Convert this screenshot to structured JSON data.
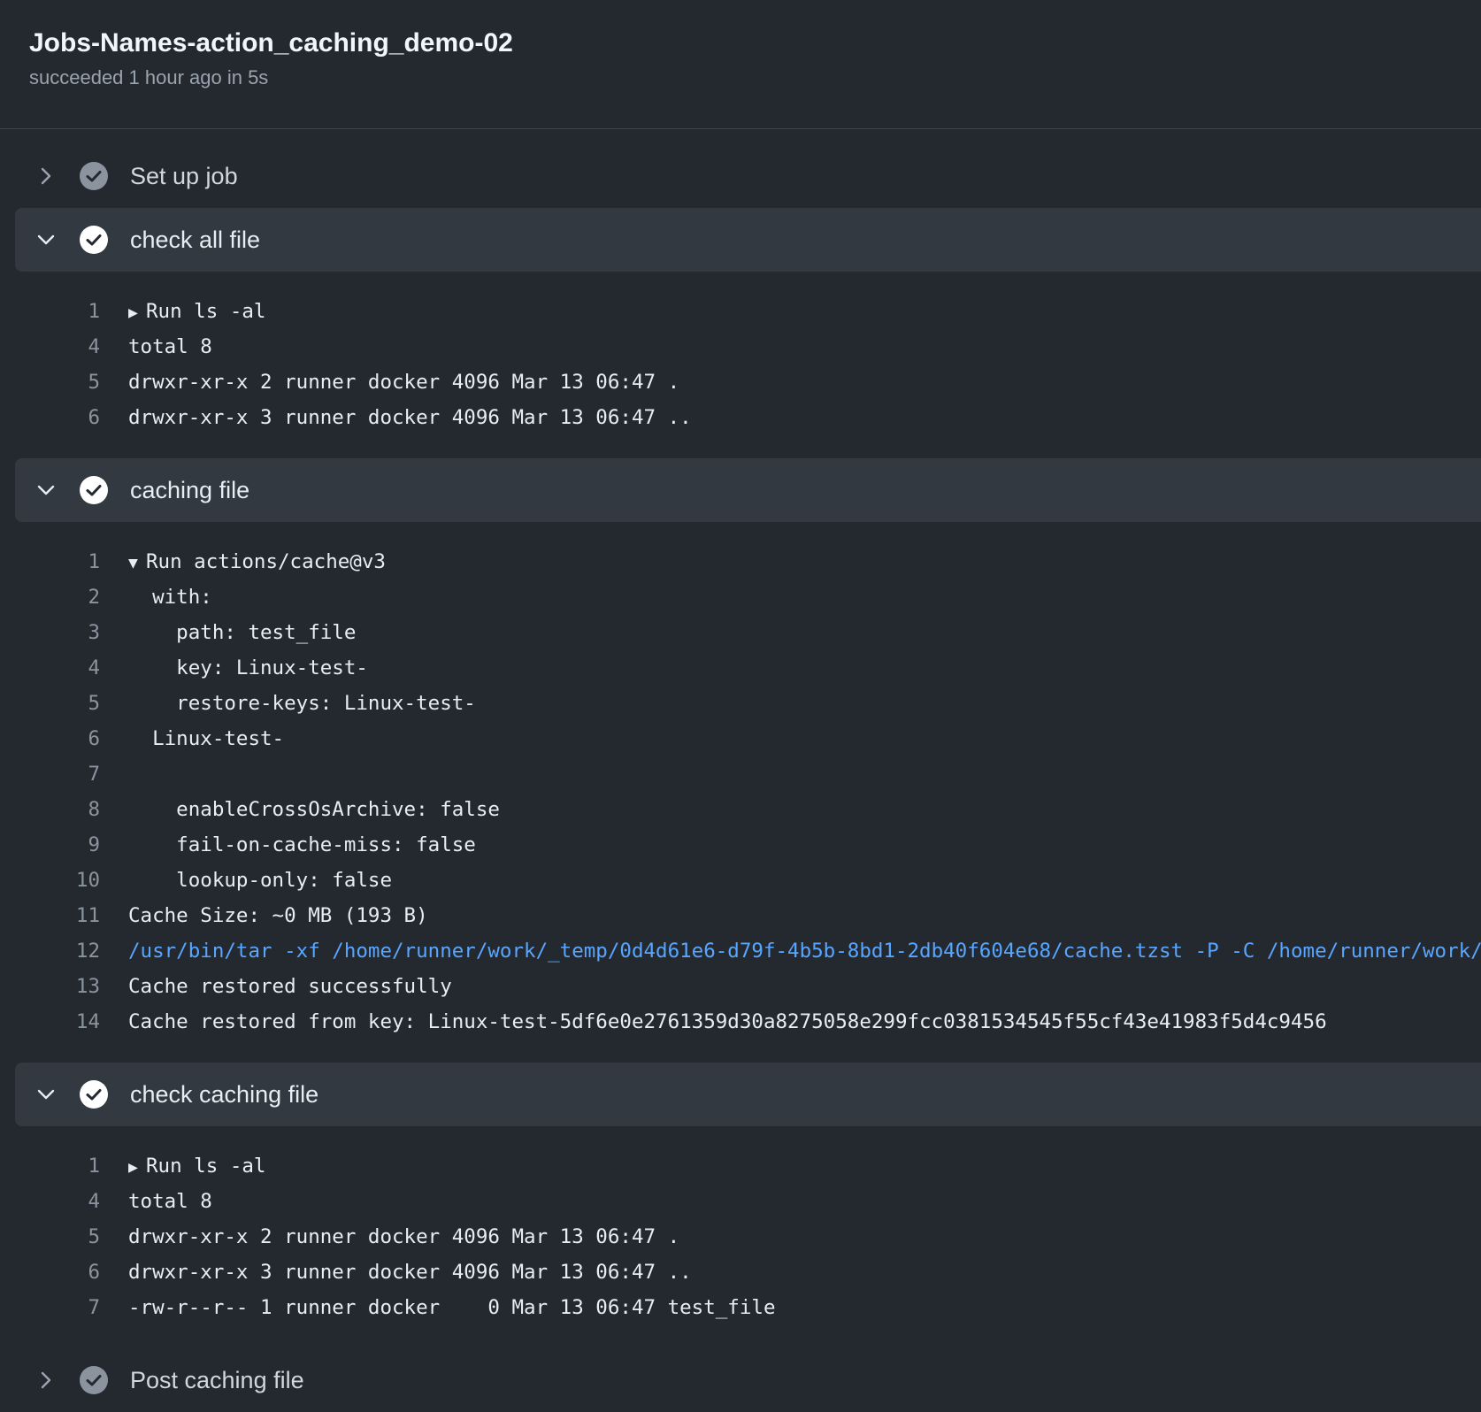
{
  "job": {
    "title": "Jobs-Names-action_caching_demo-02",
    "subtitle": "succeeded 1 hour ago in 5s"
  },
  "icons": {
    "chevron_right": "chevron-right-icon",
    "chevron_down": "chevron-down-icon",
    "check_circle": "check-circle-icon",
    "triangle_right": "▶",
    "triangle_down": "▼"
  },
  "colors": {
    "background": "#24292f",
    "step_header_bg": "#323941",
    "success_check": "#ffffff",
    "pending_check": "#8b949e",
    "command_text": "#58a6ff"
  },
  "steps": [
    {
      "name": "Set up job",
      "expanded": false,
      "lines": []
    },
    {
      "name": "check all file",
      "expanded": true,
      "lines": [
        {
          "n": "1",
          "text": "Run ls -al",
          "group": "collapsed"
        },
        {
          "n": "4",
          "text": "total 8"
        },
        {
          "n": "5",
          "text": "drwxr-xr-x 2 runner docker 4096 Mar 13 06:47 ."
        },
        {
          "n": "6",
          "text": "drwxr-xr-x 3 runner docker 4096 Mar 13 06:47 .."
        }
      ]
    },
    {
      "name": "caching file",
      "expanded": true,
      "lines": [
        {
          "n": "1",
          "text": "Run actions/cache@v3",
          "group": "expanded"
        },
        {
          "n": "2",
          "text": "  with:"
        },
        {
          "n": "3",
          "text": "    path: test_file"
        },
        {
          "n": "4",
          "text": "    key: Linux-test-"
        },
        {
          "n": "5",
          "text": "    restore-keys: Linux-test-"
        },
        {
          "n": "6",
          "text": "  Linux-test-"
        },
        {
          "n": "7",
          "text": ""
        },
        {
          "n": "8",
          "text": "    enableCrossOsArchive: false"
        },
        {
          "n": "9",
          "text": "    fail-on-cache-miss: false"
        },
        {
          "n": "10",
          "text": "    lookup-only: false"
        },
        {
          "n": "11",
          "text": "Cache Size: ~0 MB (193 B)"
        },
        {
          "n": "12",
          "text": "/usr/bin/tar -xf /home/runner/work/_temp/0d4d61e6-d79f-4b5b-8bd1-2db40f604e68/cache.tzst -P -C /home/runner/work/sre",
          "kind": "cmd"
        },
        {
          "n": "13",
          "text": "Cache restored successfully"
        },
        {
          "n": "14",
          "text": "Cache restored from key: Linux-test-5df6e0e2761359d30a8275058e299fcc0381534545f55cf43e41983f5d4c9456"
        }
      ]
    },
    {
      "name": "check caching file",
      "expanded": true,
      "lines": [
        {
          "n": "1",
          "text": "Run ls -al",
          "group": "collapsed"
        },
        {
          "n": "4",
          "text": "total 8"
        },
        {
          "n": "5",
          "text": "drwxr-xr-x 2 runner docker 4096 Mar 13 06:47 ."
        },
        {
          "n": "6",
          "text": "drwxr-xr-x 3 runner docker 4096 Mar 13 06:47 .."
        },
        {
          "n": "7",
          "text": "-rw-r--r-- 1 runner docker    0 Mar 13 06:47 test_file"
        }
      ]
    },
    {
      "name": "Post caching file",
      "expanded": false,
      "lines": []
    }
  ]
}
